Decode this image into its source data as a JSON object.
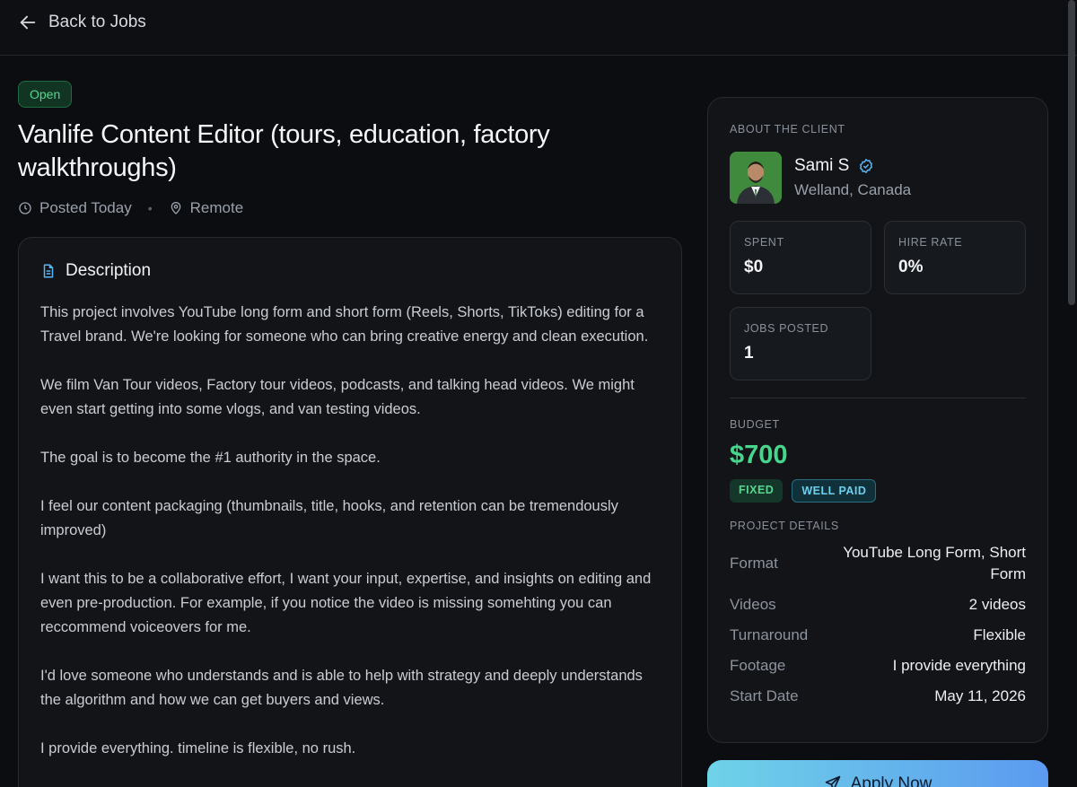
{
  "topbar": {
    "back_label": "Back to Jobs"
  },
  "job": {
    "status": "Open",
    "title": "Vanlife Content Editor (tours, education, factory walkthroughs)",
    "posted": "Posted Today",
    "location": "Remote"
  },
  "description": {
    "heading": "Description",
    "paragraphs": [
      "This project involves YouTube long form and short form (Reels, Shorts, TikToks) editing for a Travel brand. We're looking for someone who can bring creative energy and clean execution.",
      "We film Van Tour videos, Factory tour videos, podcasts, and talking head videos. We might even start getting into some vlogs, and van testing videos.",
      "The goal is to become the #1 authority in the space.",
      "I feel our content packaging (thumbnails, title, hooks, and retention can be tremendously improved)",
      "I want this to be a collaborative effort, I want your input, expertise, and insights on editing and even pre-production. For example, if you notice the video is missing somehting you can reccommend voiceovers for me.",
      "I'd love someone who understands and is able to help with strategy and deeply understands the algorithm and how we can get buyers and views.",
      "I provide everything. timeline is flexible, no rush."
    ]
  },
  "client": {
    "section_label": "ABOUT THE CLIENT",
    "name": "Sami S",
    "location": "Welland, Canada",
    "stats": {
      "spent_label": "SPENT",
      "spent": "$0",
      "hire_rate_label": "HIRE RATE",
      "hire_rate": "0%",
      "jobs_posted_label": "JOBS POSTED",
      "jobs_posted": "1"
    }
  },
  "budget": {
    "label": "BUDGET",
    "amount": "$700",
    "tags": [
      "FIXED",
      "WELL PAID"
    ]
  },
  "project_details": {
    "label": "PROJECT DETAILS",
    "rows": [
      {
        "key": "Format",
        "value": "YouTube Long Form, Short Form"
      },
      {
        "key": "Videos",
        "value": "2 videos"
      },
      {
        "key": "Turnaround",
        "value": "Flexible"
      },
      {
        "key": "Footage",
        "value": "I provide everything"
      },
      {
        "key": "Start Date",
        "value": "May 11, 2026"
      }
    ]
  },
  "apply_label": "Apply Now",
  "colors": {
    "accent_green": "#46d68b",
    "accent_cyan": "#6cd0ec",
    "background": "#0b0d11"
  }
}
